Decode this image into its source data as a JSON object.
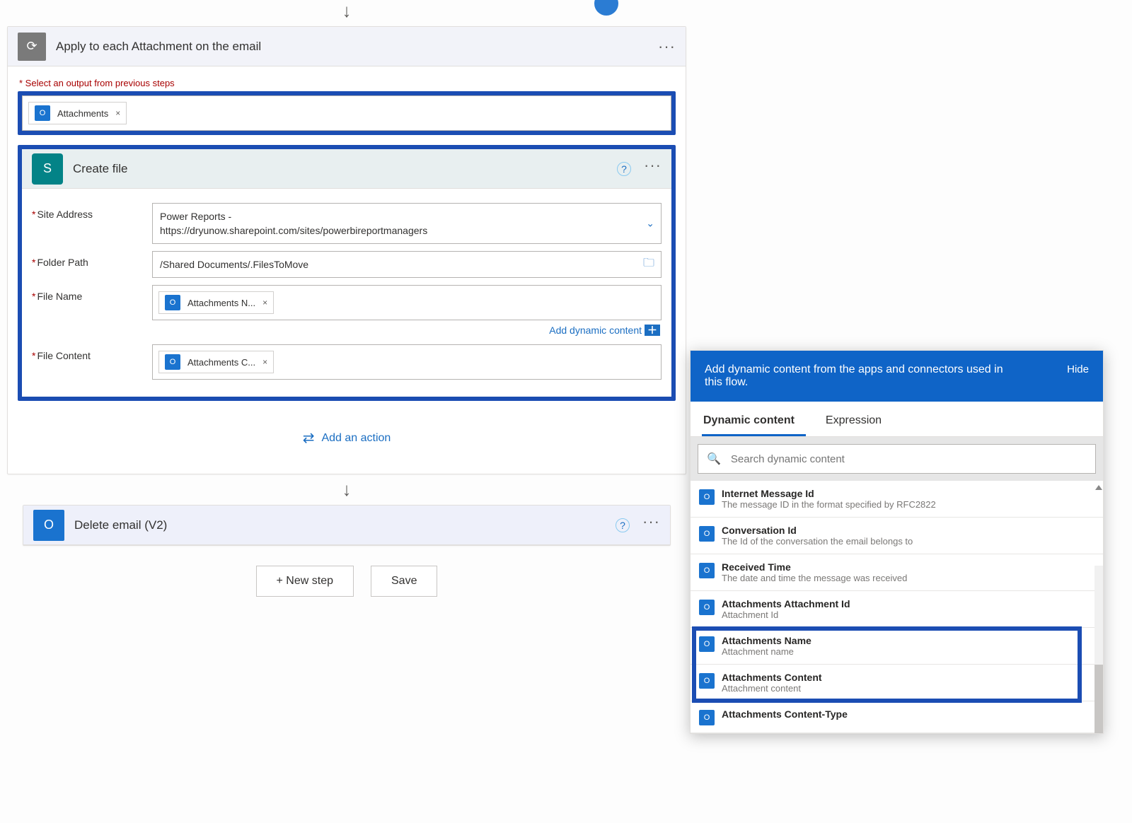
{
  "flow": {
    "applyEach": {
      "title": "Apply to each Attachment on the email",
      "selectOutputLabel": "Select an output from previous steps",
      "token": "Attachments"
    },
    "createFile": {
      "title": "Create file",
      "fields": {
        "siteAddress": {
          "label": "Site Address",
          "value": "Power Reports -\nhttps://dryunow.sharepoint.com/sites/powerbireportmanagers"
        },
        "folderPath": {
          "label": "Folder Path",
          "value": "/Shared Documents/.FilesToMove"
        },
        "fileName": {
          "label": "File Name",
          "token": "Attachments N..."
        },
        "fileContent": {
          "label": "File Content",
          "token": "Attachments C..."
        }
      },
      "addDynamic": "Add dynamic content"
    },
    "addAction": "Add an action",
    "deleteEmail": {
      "title": "Delete email (V2)"
    },
    "buttons": {
      "newStep": "+ New step",
      "save": "Save"
    }
  },
  "dynamic": {
    "header": "Add dynamic content from the apps and connectors used in this flow.",
    "hide": "Hide",
    "tabs": {
      "dc": "Dynamic content",
      "expr": "Expression"
    },
    "searchPlaceholder": "Search dynamic content",
    "items": [
      {
        "title": "Internet Message Id",
        "desc": "The message ID in the format specified by RFC2822"
      },
      {
        "title": "Conversation Id",
        "desc": "The Id of the conversation the email belongs to"
      },
      {
        "title": "Received Time",
        "desc": "The date and time the message was received"
      },
      {
        "title": "Attachments Attachment Id",
        "desc": "Attachment Id"
      },
      {
        "title": "Attachments Name",
        "desc": "Attachment name"
      },
      {
        "title": "Attachments Content",
        "desc": "Attachment content"
      },
      {
        "title": "Attachments Content-Type",
        "desc": ""
      }
    ]
  },
  "icons": {
    "loop": "⟳",
    "sharepoint": "S",
    "outlook": "O",
    "close": "×",
    "chevron": "⌄",
    "folder": "🗀",
    "help": "?",
    "dots": "···",
    "search": "🔍",
    "transfer": "⇄",
    "arrowDown": "↓",
    "plusSquare": "＋"
  }
}
